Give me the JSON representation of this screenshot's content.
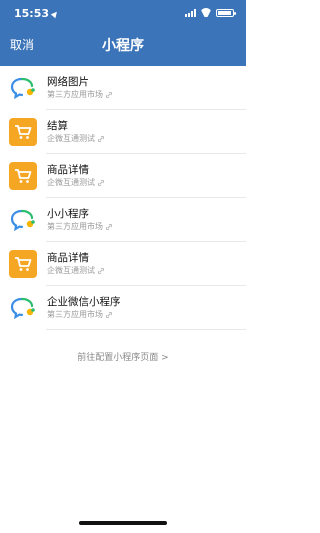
{
  "status_bar": {
    "time": "15:53"
  },
  "navbar": {
    "cancel_label": "取消",
    "title": "小程序"
  },
  "items": [
    {
      "title": "网络图片",
      "subtitle": "第三方应用市场",
      "icon": "chat-bubble-icon"
    },
    {
      "title": "结算",
      "subtitle": "企微互通测试",
      "icon": "shopping-cart-icon"
    },
    {
      "title": "商品详情",
      "subtitle": "企微互通测试",
      "icon": "shopping-cart-icon"
    },
    {
      "title": "小小程序",
      "subtitle": "第三方应用市场",
      "icon": "chat-bubble-icon"
    },
    {
      "title": "商品详情",
      "subtitle": "企微互通测试",
      "icon": "shopping-cart-icon"
    },
    {
      "title": "企业微信小程序",
      "subtitle": "第三方应用市场",
      "icon": "chat-bubble-icon"
    }
  ],
  "config_link": "前往配置小程序页面 >",
  "colors": {
    "header": "#3c74b9",
    "cart_bg": "#f5a623",
    "chat_blue": "#3a8ee6",
    "chat_green": "#2dbd6e",
    "chat_yellow": "#f5b400"
  }
}
